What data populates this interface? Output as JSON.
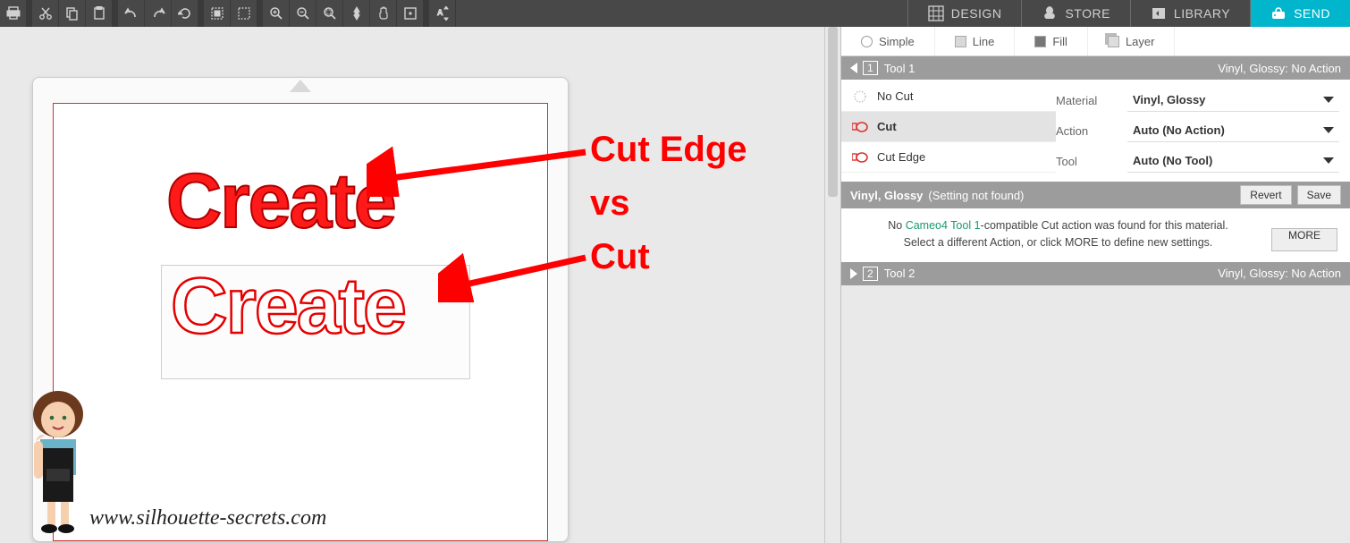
{
  "toolbar": {
    "icons": [
      "print",
      "cut",
      "copy",
      "paste",
      "undo",
      "redo",
      "refresh",
      "select-all",
      "select-rect",
      "zoom-in",
      "zoom-out",
      "zoom-fit",
      "zoom-selection",
      "pan",
      "fit-page",
      "text-direction"
    ]
  },
  "navtabs": {
    "design": "DESIGN",
    "store": "STORE",
    "library": "LIBRARY",
    "send": "SEND"
  },
  "subtabs": {
    "simple": "Simple",
    "line": "Line",
    "fill": "Fill",
    "layer": "Layer"
  },
  "tool1": {
    "label": "Tool 1",
    "status_prefix": "Vinyl, Glossy:",
    "status_action": "No Action",
    "options": {
      "nocut": "No Cut",
      "cut": "Cut",
      "cutedge": "Cut Edge"
    },
    "settings": {
      "material_lbl": "Material",
      "material_val": "Vinyl, Glossy",
      "action_lbl": "Action",
      "action_val": "Auto (No Action)",
      "tool_lbl": "Tool",
      "tool_val": "Auto (No Tool)"
    }
  },
  "notfound": {
    "title_bold": "Vinyl, Glossy",
    "title_rest": "(Setting not found)",
    "revert": "Revert",
    "save": "Save"
  },
  "msg": {
    "line1a": "No ",
    "line1b": "Cameo4 Tool 1",
    "line1c": "-compatible Cut action was found for this material.",
    "line2": "Select a different Action, or click MORE to define new settings.",
    "more": "MORE"
  },
  "tool2": {
    "label": "Tool 2",
    "status_prefix": "Vinyl, Glossy:",
    "status_action": "No Action"
  },
  "canvas": {
    "text1": "Create",
    "text2": "Create"
  },
  "annotations": {
    "a1": "Cut Edge",
    "a2": "vs",
    "a3": "Cut"
  },
  "watermark": "www.silhouette-secrets.com"
}
